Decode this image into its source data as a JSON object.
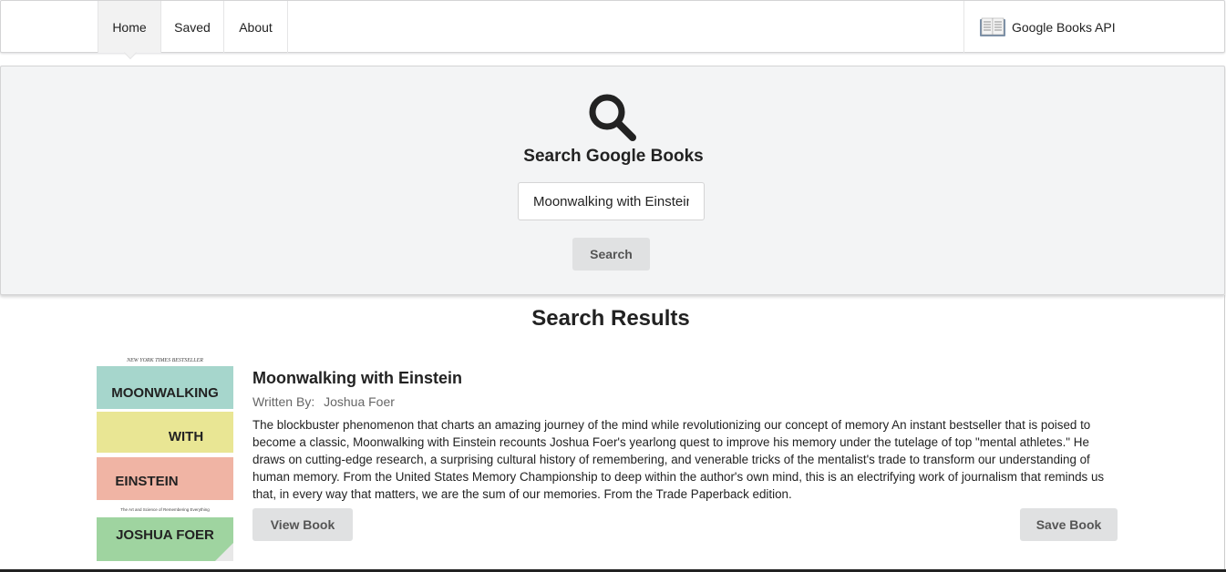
{
  "nav": {
    "items": [
      {
        "label": "Home",
        "active": true
      },
      {
        "label": "Saved",
        "active": false
      },
      {
        "label": "About",
        "active": false
      }
    ],
    "brand_label": "Google Books API",
    "brand_icon": "book-icon"
  },
  "search": {
    "icon": "search-icon",
    "heading": "Search Google Books",
    "input_value": "Moonwalking with Einstein",
    "button_label": "Search"
  },
  "results": {
    "heading": "Search Results",
    "books": [
      {
        "title": "Moonwalking with Einstein",
        "written_by_label": "Written By:",
        "author": "Joshua Foer",
        "description": "The blockbuster phenomenon that charts an amazing journey of the mind while revolutionizing our concept of memory An instant bestseller that is poised to become a classic, Moonwalking with Einstein recounts Joshua Foer's yearlong quest to improve his memory under the tutelage of top \"mental athletes.\" He draws on cutting-edge research, a surprising cultural history of remembering, and venerable tricks of the mentalist's trade to transform our understanding of human memory. From the United States Memory Championship to deep within the author's own mind, this is an electrifying work of journalism that reminds us that, in every way that matters, we are the sum of our memories. From the Trade Paperback edition.",
        "cover": {
          "banner": "NEW YORK TIMES BESTSELLER",
          "line1": "MOONWALKING",
          "line2": "WITH",
          "line3": "EINSTEIN",
          "subtitle": "The Art and Science of Remembering Everything",
          "author": "JOSHUA FOER"
        },
        "view_label": "View Book",
        "save_label": "Save Book"
      }
    ]
  },
  "colors": {
    "segment_bg": "#f3f4f5",
    "button_bg": "#e0e1e2",
    "active_nav_bg": "#f2f2f2"
  }
}
